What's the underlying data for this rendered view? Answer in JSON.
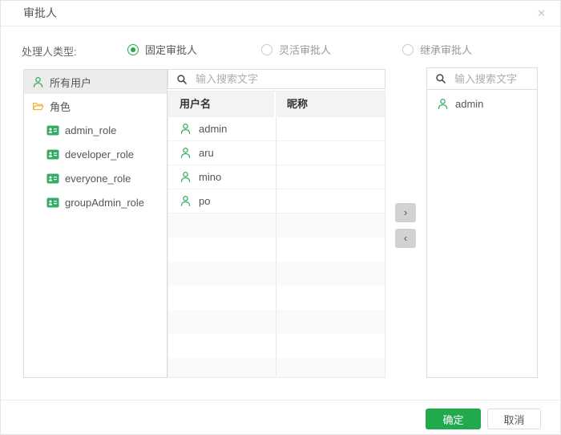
{
  "dialog": {
    "title": "审批人",
    "close_glyph": "✕"
  },
  "type_selector": {
    "label": "处理人类型:",
    "options": [
      {
        "label": "固定审批人",
        "selected": true
      },
      {
        "label": "灵活审批人",
        "selected": false
      },
      {
        "label": "继承审批人",
        "selected": false
      }
    ]
  },
  "tree": {
    "items": [
      {
        "label": "所有用户",
        "icon": "user-icon",
        "selected": true
      },
      {
        "label": "角色",
        "icon": "folder-open-icon",
        "selected": false
      },
      {
        "label": "admin_role",
        "icon": "role-card-icon",
        "selected": false
      },
      {
        "label": "developer_role",
        "icon": "role-card-icon",
        "selected": false
      },
      {
        "label": "everyone_role",
        "icon": "role-card-icon",
        "selected": false
      },
      {
        "label": "groupAdmin_role",
        "icon": "role-card-icon",
        "selected": false
      }
    ]
  },
  "source_panel": {
    "search_placeholder": "输入搜索文字",
    "columns": [
      "用户名",
      "昵称"
    ],
    "rows": [
      {
        "username": "admin",
        "nickname": ""
      },
      {
        "username": "aru",
        "nickname": ""
      },
      {
        "username": "mino",
        "nickname": ""
      },
      {
        "username": "po",
        "nickname": ""
      }
    ]
  },
  "transfer": {
    "to_right_glyph": "›",
    "to_left_glyph": "‹"
  },
  "target_panel": {
    "search_placeholder": "输入搜索文字",
    "items": [
      {
        "label": "admin",
        "icon": "user-icon"
      }
    ]
  },
  "footer": {
    "ok_label": "确定",
    "cancel_label": "取消"
  },
  "colors": {
    "accent_green": "#21a94e",
    "icon_green": "#36ab66",
    "folder_yellow": "#f2b63c"
  }
}
